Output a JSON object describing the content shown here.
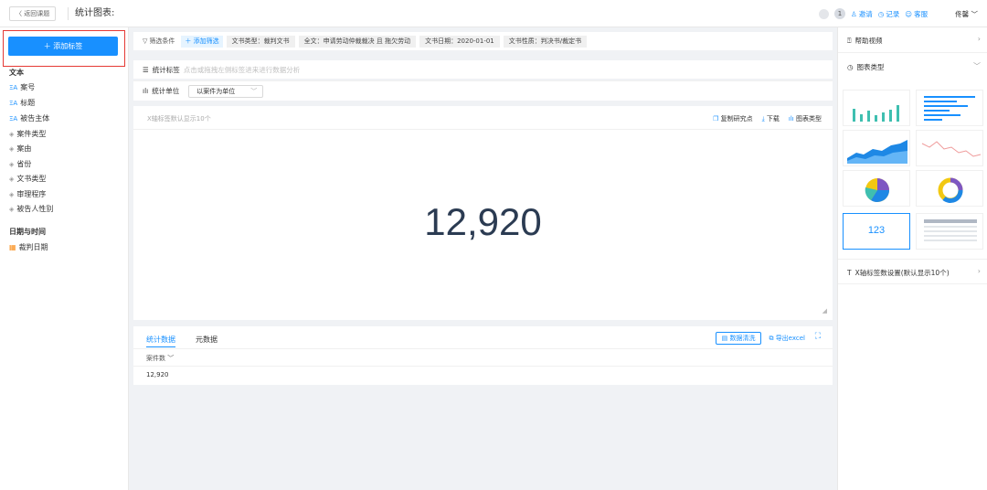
{
  "header": {
    "back_label": "〈 返回课题",
    "title": "统计图表:",
    "notification_count": "1",
    "links": [
      "邀请",
      "记录",
      "客服"
    ],
    "user_name": "佟馨"
  },
  "left_panel": {
    "add_button": "＋ 添加标签",
    "groups": [
      {
        "title": "文本",
        "items": [
          {
            "label": "案号",
            "icon": "text-field-icon"
          },
          {
            "label": "标题",
            "icon": "text-field-icon"
          },
          {
            "label": "被告主体",
            "icon": "text-field-icon"
          },
          {
            "label": "案件类型",
            "icon": "category-field-icon"
          },
          {
            "label": "案由",
            "icon": "category-field-icon"
          },
          {
            "label": "省份",
            "icon": "category-field-icon"
          },
          {
            "label": "文书类型",
            "icon": "category-field-icon"
          },
          {
            "label": "审理程序",
            "icon": "category-field-icon"
          },
          {
            "label": "被告人性别",
            "icon": "category-field-icon"
          }
        ]
      },
      {
        "title": "日期与时间",
        "items": [
          {
            "label": "裁判日期",
            "icon": "calendar-icon"
          }
        ]
      }
    ]
  },
  "filter_bar": {
    "label": "筛选条件",
    "add_label": "＋ 添加筛选",
    "chips": [
      "文书类型：裁判文书",
      "全文：申请劳动仲裁裁决 且 拖欠劳动",
      "文书日期：2020-01-01",
      "文书性质：判决书/裁定书"
    ]
  },
  "stat_tag": {
    "label": "统计标签",
    "placeholder": "点击或拖拽左侧标签进来进行数据分析"
  },
  "stat_unit": {
    "label": "统计单位",
    "selected": "以案件为单位"
  },
  "chart_panel": {
    "x_axis_note": "X轴标签默认显示10个",
    "actions": [
      "复制研究点",
      "下载",
      "图表类型"
    ],
    "big_number": "12,920"
  },
  "data_panel": {
    "tabs": [
      "统计数据",
      "元数据"
    ],
    "clean_button": "数据清洗",
    "export_button": "导出excel",
    "column_header": "案件数",
    "cell_value": "12,920"
  },
  "right_panel": {
    "help_video": "帮助视频",
    "chart_type_label": "图表类型",
    "number_thumb": "123",
    "x_axis_setting": "X轴标签数设置(默认显示10个)"
  },
  "colors": {
    "accent": "#1890ff",
    "highlight_box": "#e53935"
  }
}
